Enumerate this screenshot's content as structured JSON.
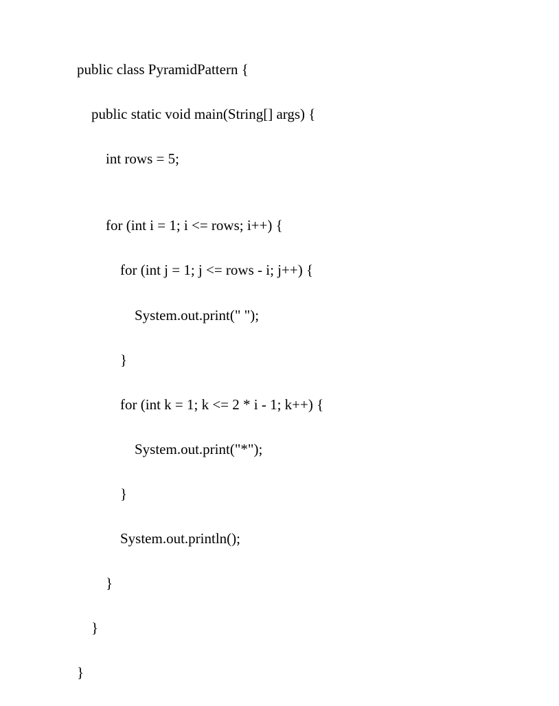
{
  "code": {
    "line1": "public class PyramidPattern {",
    "line2": "    public static void main(String[] args) {",
    "line3": "        int rows = 5;",
    "line4": "",
    "line5": "        for (int i = 1; i <= rows; i++) {",
    "line6": "            for (int j = 1; j <= rows - i; j++) {",
    "line7": "                System.out.print(\" \");",
    "line8": "            }",
    "line9": "            for (int k = 1; k <= 2 * i - 1; k++) {",
    "line10": "                System.out.print(\"*\");",
    "line11": "            }",
    "line12": "            System.out.println();",
    "line13": "        }",
    "line14": "    }",
    "line15": "}"
  }
}
